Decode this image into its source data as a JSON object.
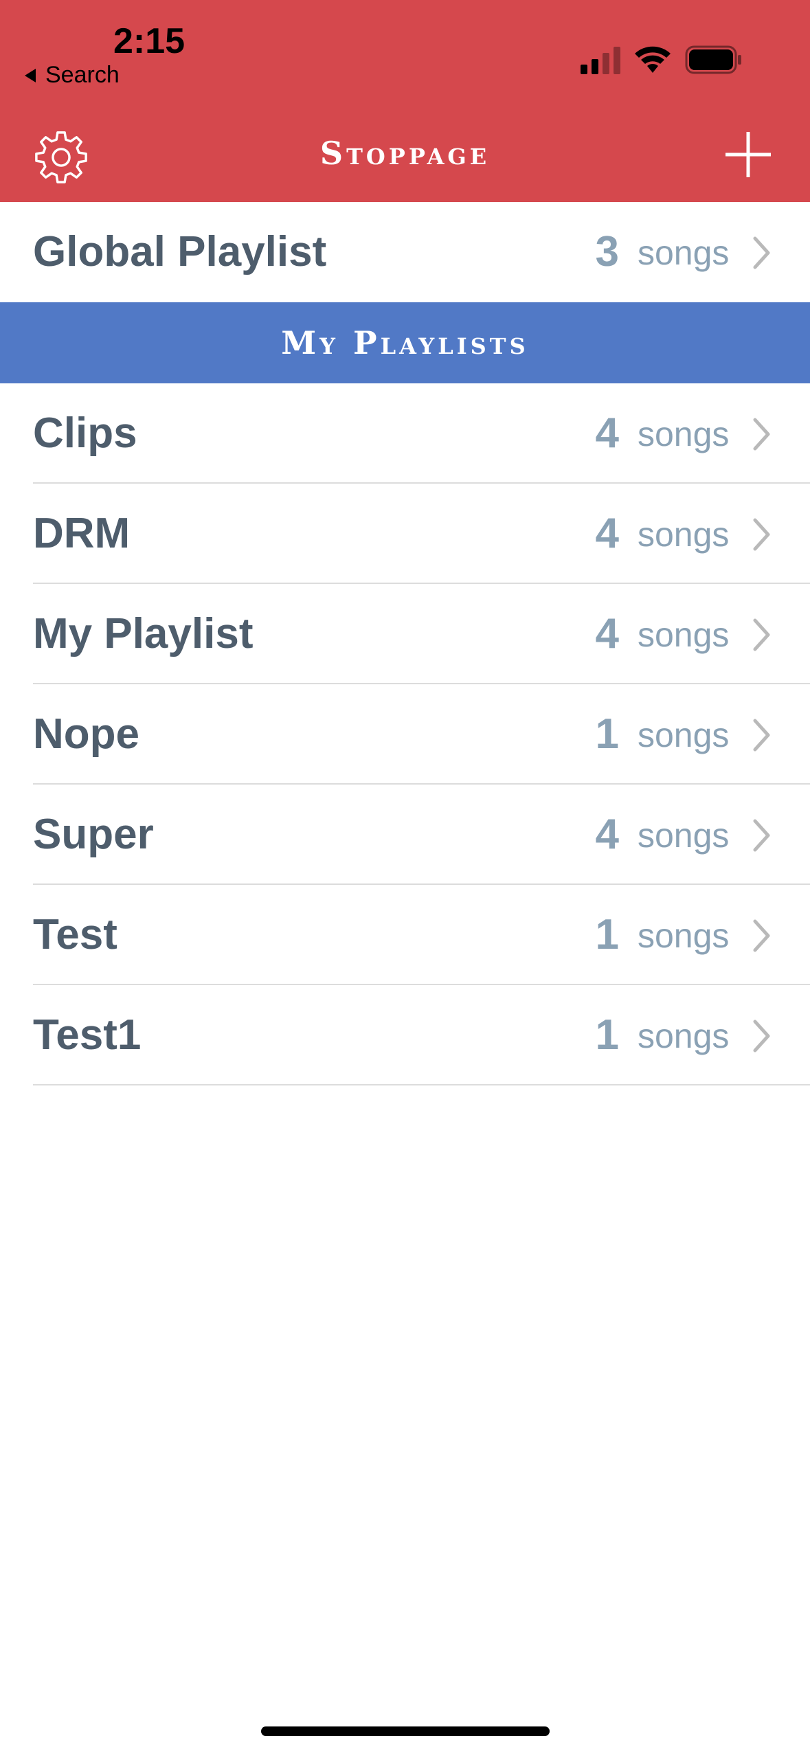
{
  "status_bar": {
    "time": "2:15",
    "back_label": "Search",
    "signal_icon": "cellular-signal-icon",
    "wifi_icon": "wifi-icon",
    "battery_icon": "battery-icon"
  },
  "nav": {
    "title": "Stoppage",
    "left_icon": "gear-icon",
    "right_icon": "plus-icon"
  },
  "global_playlist": {
    "name": "Global Playlist",
    "count": "3",
    "unit": "songs"
  },
  "section": {
    "title": "My Playlists"
  },
  "playlists": [
    {
      "name": "Clips",
      "count": "4",
      "unit": "songs"
    },
    {
      "name": "DRM",
      "count": "4",
      "unit": "songs"
    },
    {
      "name": "My Playlist",
      "count": "4",
      "unit": "songs"
    },
    {
      "name": "Nope",
      "count": "1",
      "unit": "songs"
    },
    {
      "name": "Super",
      "count": "4",
      "unit": "songs"
    },
    {
      "name": "Test",
      "count": "1",
      "unit": "songs"
    },
    {
      "name": "Test1",
      "count": "1",
      "unit": "songs"
    }
  ],
  "colors": {
    "nav_background": "#d5484d",
    "section_background": "#5179c6",
    "row_text": "#4e5d6c",
    "count_text": "#8aa1b4",
    "chevron": "#b9b9b9"
  }
}
